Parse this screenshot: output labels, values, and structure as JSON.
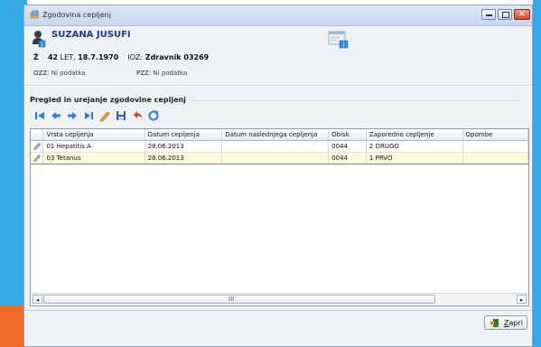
{
  "window": {
    "title": "Zgodovina cepljenj"
  },
  "patient": {
    "name": "SUZANA JUSUFI",
    "sex": "Ž",
    "age": "42",
    "age_unit": "LET,",
    "birth_date": "18.7.1970",
    "ioz_label": "IOZ:",
    "doctor": "Zdravnik 03269",
    "ozz_label": "OZZ:",
    "ozz_value": "Ni podatka",
    "pzz_label": "PZZ:",
    "pzz_value": "Ni podatka"
  },
  "section": {
    "title": "Pregled in urejanje zgodovine cepljenj"
  },
  "toolbar": {
    "icons": [
      "first-icon",
      "previous-icon",
      "next-icon",
      "last-icon",
      "edit-icon",
      "save-icon",
      "undo-icon",
      "refresh-icon"
    ]
  },
  "table": {
    "columns": [
      "",
      "Vrsta cepljenja",
      "Datum cepljenja",
      "Datum naslednjega cepljenja",
      "Obisk",
      "Zaporedno cepljenje",
      "Opombe"
    ],
    "rows": [
      {
        "vrsta": "01 Hepatitis A",
        "datum": "28.06.2013",
        "naslednje": "",
        "obisk": "0044",
        "zaporedno": "2 DRUGO",
        "opombe": ""
      },
      {
        "vrsta": "03 Tetanus",
        "datum": "28.06.2013",
        "naslednje": "",
        "obisk": "0044",
        "zaporedno": "1 PRVO",
        "opombe": ""
      }
    ],
    "scroll_thumb": "III"
  },
  "footer": {
    "close_label_underlined": "Z",
    "close_label_rest": "apri"
  },
  "colors": {
    "accent_left": "#33a9e6",
    "accent_orange": "#ef6a28",
    "selected_row": "#fffad6",
    "name_color": "#1c3a8c"
  }
}
